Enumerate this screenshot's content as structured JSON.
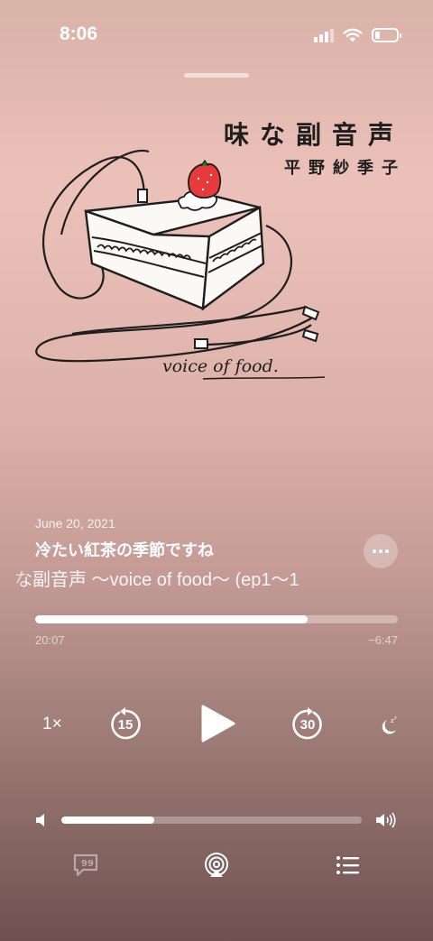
{
  "status_bar": {
    "time": "8:06"
  },
  "artwork": {
    "title": "味な副音声",
    "author": "平野紗季子",
    "handwritten_caption": "voice of food."
  },
  "episode": {
    "date": "June 20, 2021",
    "title": "冷たい紅茶の季節ですね",
    "show": "な副音声 〜voice of food〜 (ep1〜1"
  },
  "playback": {
    "elapsed": "20:07",
    "remaining": "−6:47",
    "progress_fraction": 0.75,
    "speed": "1×",
    "skip_back_seconds": "15",
    "skip_forward_seconds": "30"
  },
  "volume": {
    "level_fraction": 0.31
  },
  "icons": {
    "more": "ellipsis-icon",
    "play": "play-icon",
    "sleep": "moon-sleep-icon",
    "volume_low": "speaker-low-icon",
    "volume_high": "speaker-high-icon",
    "lyrics": "quote-bubble-icon",
    "airplay": "airplay-icon",
    "queue": "list-icon"
  },
  "colors": {
    "accent": "#ffffff",
    "strawberry": "#e8393b"
  }
}
